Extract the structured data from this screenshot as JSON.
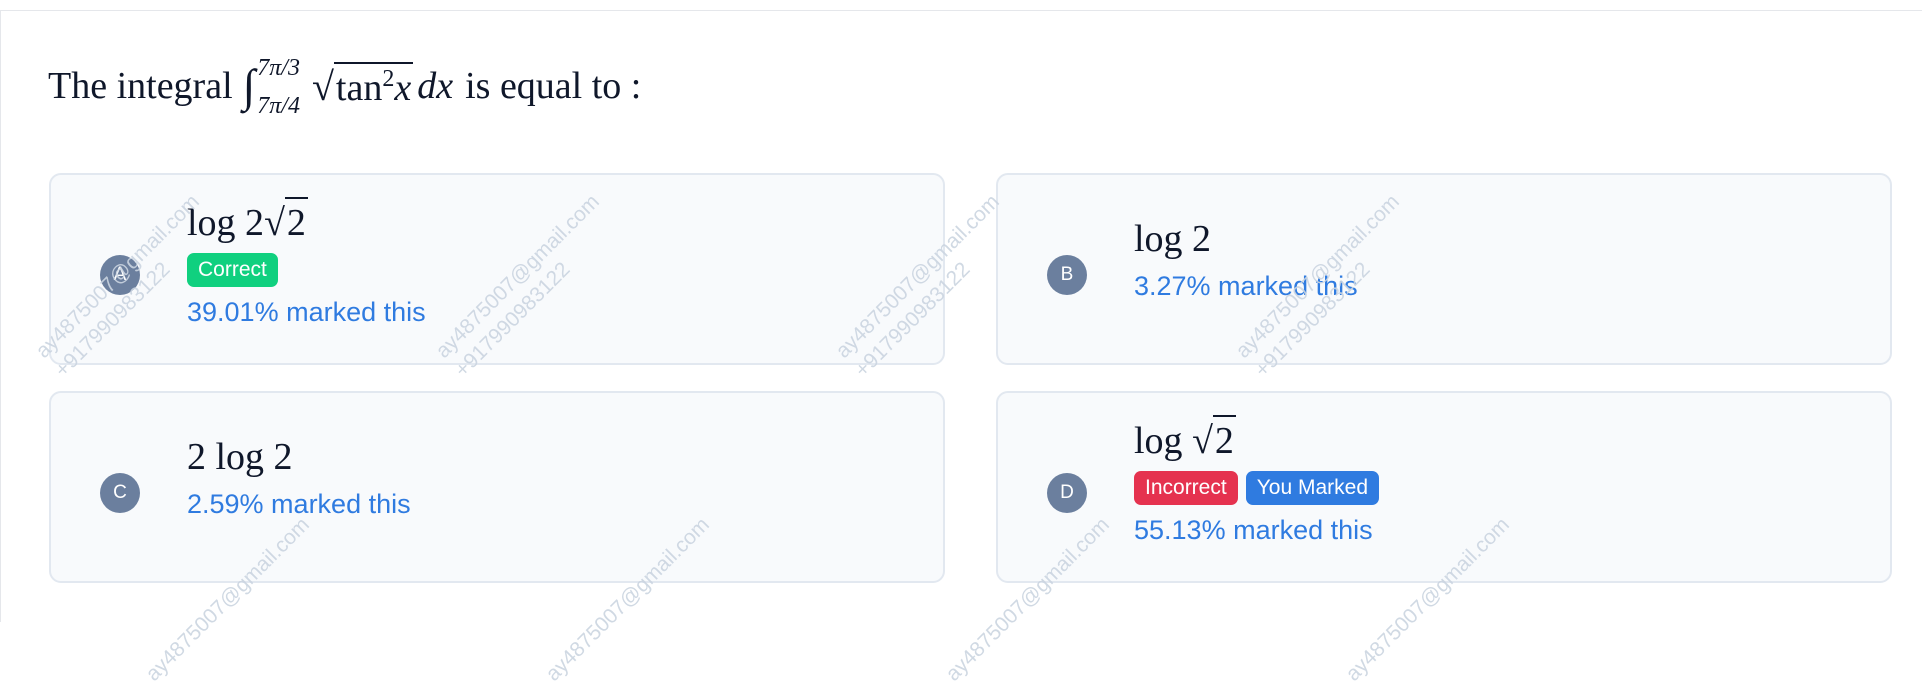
{
  "question": {
    "prefix": "The integral",
    "integral_sign": "∫",
    "upper_limit": "7π/3",
    "lower_limit": "7π/4",
    "radical": "√",
    "integrand_fn": "tan",
    "integrand_exp": "2",
    "integrand_var": "x",
    "differential": "dx",
    "suffix": "is equal to :"
  },
  "options": [
    {
      "letter": "A",
      "math_pre": "log 2",
      "math_rad": "2",
      "badges": [
        "Correct"
      ],
      "percent_text": "39.01% marked this"
    },
    {
      "letter": "B",
      "math_pre": "log 2",
      "math_rad": "",
      "badges": [],
      "percent_text": "3.27% marked this"
    },
    {
      "letter": "C",
      "math_pre": "2 log 2",
      "math_rad": "",
      "badges": [],
      "percent_text": "2.59% marked this"
    },
    {
      "letter": "D",
      "math_pre": "log ",
      "math_rad": "2",
      "badges": [
        "Incorrect",
        "You Marked"
      ],
      "percent_text": "55.13% marked this"
    }
  ],
  "watermark": {
    "email": "ay4875007@gmail.com",
    "phone": "+917990983122"
  },
  "colors": {
    "correct": "#10d07f",
    "incorrect": "#e5324f",
    "marked": "#2f7be0",
    "percent_text": "#2f7be0",
    "letter_circle": "#6b7f9e"
  }
}
